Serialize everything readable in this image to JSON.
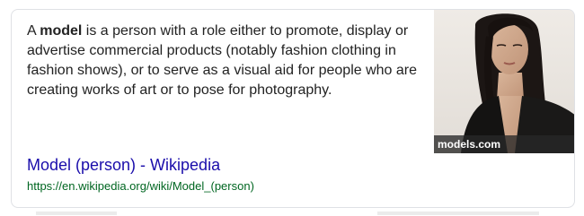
{
  "snippet": {
    "prefix": "A ",
    "term": "model",
    "text": " is a person with a role either to promote, display or advertise commercial products (notably fashion clothing in fashion shows), or to serve as a visual aid for people who are creating works of art or to pose for photography."
  },
  "image": {
    "source_caption": "models.com"
  },
  "result": {
    "title": "Model (person) - Wikipedia",
    "url": "https://en.wikipedia.org/wiki/Model_(person)"
  },
  "colors": {
    "link": "#1a0dab",
    "url": "#006621",
    "text": "#222222",
    "border": "#dfe1e5"
  }
}
